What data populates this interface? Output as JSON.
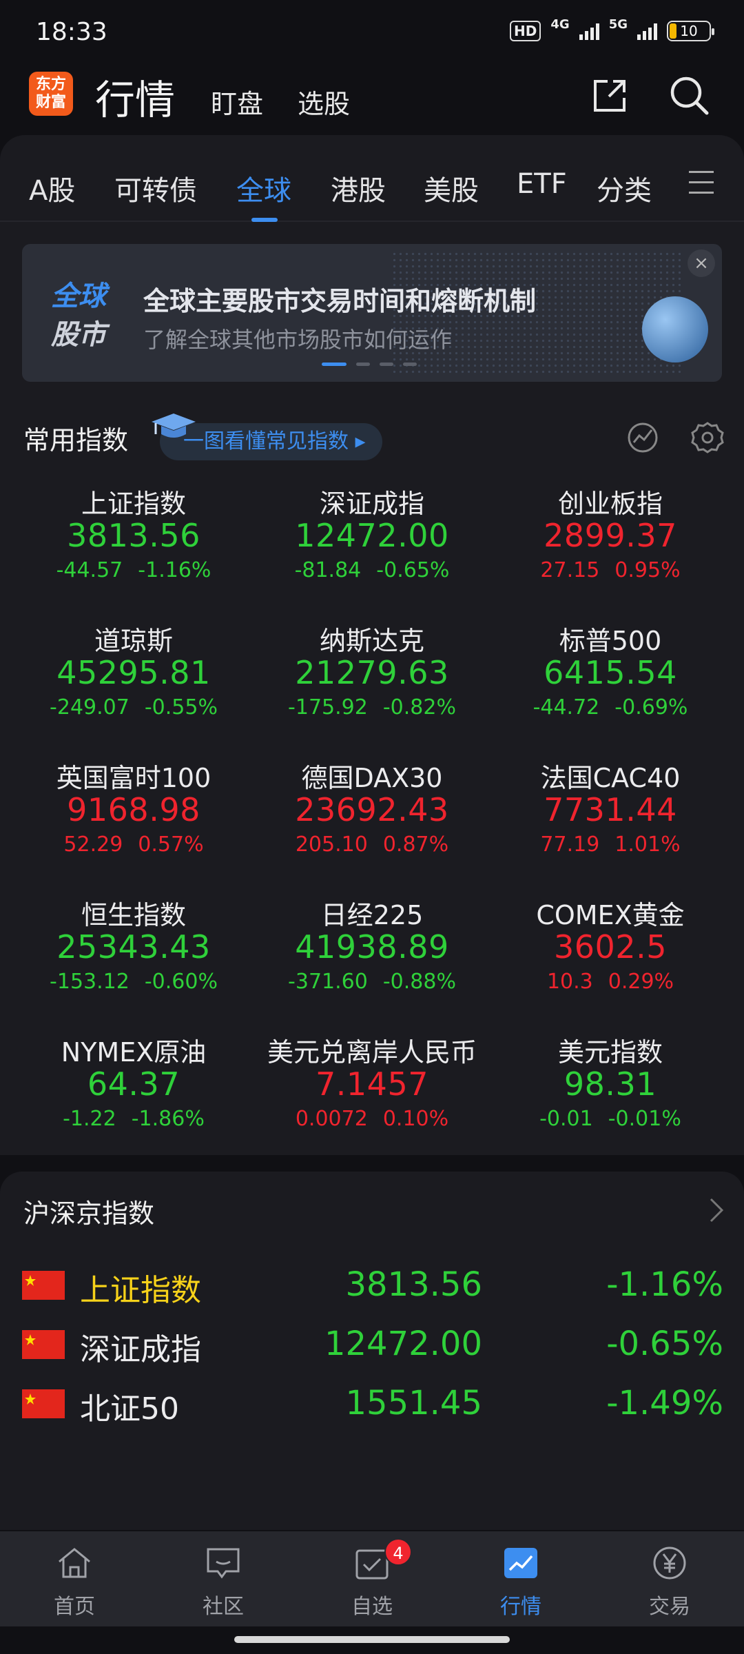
{
  "status_bar": {
    "time": "18:33",
    "hd": "HD",
    "net1": "4G",
    "net2": "5G",
    "battery": "10"
  },
  "header": {
    "logo_line1": "东方",
    "logo_line2": "财富",
    "title": "行情",
    "tab1": "盯盘",
    "tab2": "选股",
    "share_icon": "share-icon",
    "search_icon": "search-icon"
  },
  "market_tabs": [
    "A股",
    "可转债",
    "全球",
    "港股",
    "美股",
    "ETF",
    "分类"
  ],
  "active_market_tab": "全球",
  "banner": {
    "logo_line1": "全球",
    "logo_line2": "股市",
    "title": "全球主要股市交易时间和熔断机制",
    "subtitle": "了解全球其他市场股市如何运作"
  },
  "indices_section": {
    "title": "常用指数",
    "guide": "一图看懂常见指数 ▸",
    "items": [
      {
        "name": "上证指数",
        "price": "3813.56",
        "change": "-44.57",
        "pct": "-1.16%",
        "trend": "down"
      },
      {
        "name": "深证成指",
        "price": "12472.00",
        "change": "-81.84",
        "pct": "-0.65%",
        "trend": "down"
      },
      {
        "name": "创业板指",
        "price": "2899.37",
        "change": "27.15",
        "pct": "0.95%",
        "trend": "up"
      },
      {
        "name": "道琼斯",
        "price": "45295.81",
        "change": "-249.07",
        "pct": "-0.55%",
        "trend": "down"
      },
      {
        "name": "纳斯达克",
        "price": "21279.63",
        "change": "-175.92",
        "pct": "-0.82%",
        "trend": "down"
      },
      {
        "name": "标普500",
        "price": "6415.54",
        "change": "-44.72",
        "pct": "-0.69%",
        "trend": "down"
      },
      {
        "name": "英国富时100",
        "price": "9168.98",
        "change": "52.29",
        "pct": "0.57%",
        "trend": "up"
      },
      {
        "name": "德国DAX30",
        "price": "23692.43",
        "change": "205.10",
        "pct": "0.87%",
        "trend": "up"
      },
      {
        "name": "法国CAC40",
        "price": "7731.44",
        "change": "77.19",
        "pct": "1.01%",
        "trend": "up"
      },
      {
        "name": "恒生指数",
        "price": "25343.43",
        "change": "-153.12",
        "pct": "-0.60%",
        "trend": "down"
      },
      {
        "name": "日经225",
        "price": "41938.89",
        "change": "-371.60",
        "pct": "-0.88%",
        "trend": "down"
      },
      {
        "name": "COMEX黄金",
        "price": "3602.5",
        "change": "10.3",
        "pct": "0.29%",
        "trend": "up"
      },
      {
        "name": "NYMEX原油",
        "price": "64.37",
        "change": "-1.22",
        "pct": "-1.86%",
        "trend": "down"
      },
      {
        "name": "美元兑离岸人民币",
        "price": "7.1457",
        "change": "0.0072",
        "pct": "0.10%",
        "trend": "up"
      },
      {
        "name": "美元指数",
        "price": "98.31",
        "change": "-0.01",
        "pct": "-0.01%",
        "trend": "down"
      }
    ]
  },
  "list_section": {
    "title": "沪深京指数",
    "rows": [
      {
        "name": "上证指数",
        "price": "3813.56",
        "pct": "-1.16%"
      },
      {
        "name": "深证成指",
        "price": "12472.00",
        "pct": "-0.65%"
      },
      {
        "name": "北证50",
        "price": "1551.45",
        "pct": "-1.49%"
      }
    ]
  },
  "bottom_nav": {
    "items": [
      "首页",
      "社区",
      "自选",
      "行情",
      "交易"
    ],
    "badge": "4",
    "active": "行情"
  },
  "colors": {
    "up": "#f0242e",
    "down": "#2fd13a",
    "accent": "#3d8ef0",
    "brand": "#f25a1b"
  }
}
